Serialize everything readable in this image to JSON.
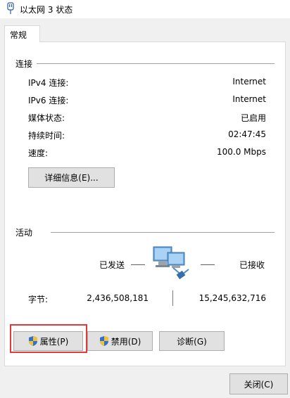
{
  "window": {
    "title": "以太网 3 状态"
  },
  "tabs": [
    {
      "label": "常规"
    }
  ],
  "connection": {
    "section_title": "连接",
    "rows": [
      {
        "label": "IPv4 连接:",
        "value": "Internet"
      },
      {
        "label": "IPv6 连接:",
        "value": "Internet"
      },
      {
        "label": "媒体状态:",
        "value": "已启用"
      },
      {
        "label": "持续时间:",
        "value": "02:47:45"
      },
      {
        "label": "速度:",
        "value": "100.0 Mbps"
      }
    ],
    "details_button": "详细信息(E)..."
  },
  "activity": {
    "section_title": "活动",
    "sent_label": "已发送",
    "received_label": "已接收",
    "bytes_label": "字节:",
    "bytes_sent": "2,436,508,181",
    "bytes_received": "15,245,632,716",
    "icon": "network-computers-icon"
  },
  "buttons": {
    "properties": "属性(P)",
    "disable": "禁用(D)",
    "diagnose": "诊断(G)",
    "close": "关闭(C)"
  },
  "colors": {
    "highlight": "#e03a3a"
  }
}
